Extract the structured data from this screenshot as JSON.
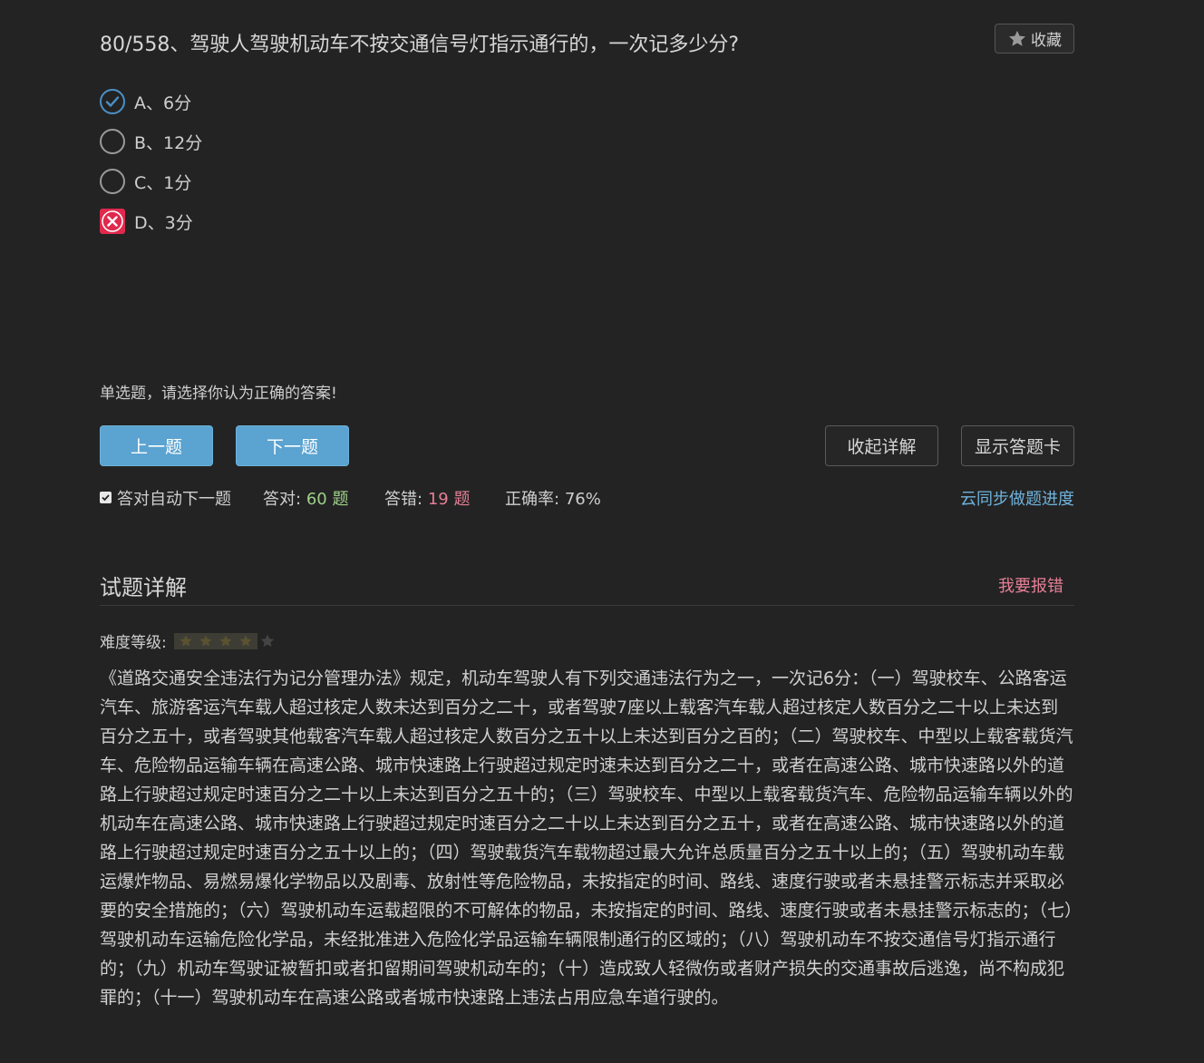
{
  "question": {
    "title": "80/558、驾驶人驾驶机动车不按交通信号灯指示通行的，一次记多少分?",
    "favorite_label": "收藏"
  },
  "options": [
    {
      "label": "A、6分",
      "state": "selected-correct"
    },
    {
      "label": "B、12分",
      "state": "unselected"
    },
    {
      "label": "C、1分",
      "state": "unselected"
    },
    {
      "label": "D、3分",
      "state": "selected-wrong"
    }
  ],
  "hint": "单选题，请选择你认为正确的答案!",
  "buttons": {
    "prev": "上一题",
    "next": "下一题",
    "collapse": "收起详解",
    "answer_card": "显示答题卡"
  },
  "stats": {
    "auto_next": "答对自动下一题",
    "auto_next_checked": true,
    "correct_label": "答对:",
    "correct_value": "60 题",
    "wrong_label": "答错:",
    "wrong_value": "19 题",
    "rate_label": "正确率:",
    "rate_value": "76%",
    "sync": "云同步做题进度"
  },
  "detail": {
    "title": "试题详解",
    "report": "我要报错",
    "difficulty_label": "难度等级:",
    "difficulty_stars": 4,
    "difficulty_max": 5,
    "explanation": "《道路交通安全违法行为记分管理办法》规定，机动车驾驶人有下列交通违法行为之一，一次记6分：（一）驾驶校车、公路客运汽车、旅游客运汽车载人超过核定人数未达到百分之二十，或者驾驶7座以上载客汽车载人超过核定人数百分之二十以上未达到百分之五十，或者驾驶其他载客汽车载人超过核定人数百分之五十以上未达到百分之百的；（二）驾驶校车、中型以上载客载货汽车、危险物品运输车辆在高速公路、城市快速路上行驶超过规定时速未达到百分之二十，或者在高速公路、城市快速路以外的道路上行驶超过规定时速百分之二十以上未达到百分之五十的；（三）驾驶校车、中型以上载客载货汽车、危险物品运输车辆以外的机动车在高速公路、城市快速路上行驶超过规定时速百分之二十以上未达到百分之五十，或者在高速公路、城市快速路以外的道路上行驶超过规定时速百分之五十以上的；（四）驾驶载货汽车载物超过最大允许总质量百分之五十以上的；（五）驾驶机动车载运爆炸物品、易燃易爆化学物品以及剧毒、放射性等危险物品，未按指定的时间、路线、速度行驶或者未悬挂警示标志并采取必要的安全措施的；（六）驾驶机动车运载超限的不可解体的物品，未按指定的时间、路线、速度行驶或者未悬挂警示标志的；（七）驾驶机动车运输危险化学品，未经批准进入危险化学品运输车辆限制通行的区域的；（八）驾驶机动车不按交通信号灯指示通行的；（九）机动车驾驶证被暂扣或者扣留期间驾驶机动车的；（十）造成致人轻微伤或者财产损失的交通事故后逃逸，尚不构成犯罪的；（十一）驾驶机动车在高速公路或者城市快速路上违法占用应急车道行驶的。"
  },
  "colors": {
    "background": "#232323",
    "blue_button": "#5ba3d0",
    "correct_green": "#9fd08a",
    "wrong_pink": "#e47f95",
    "link_blue": "#6fb3dc",
    "wrong_mark": "#e0294d"
  }
}
